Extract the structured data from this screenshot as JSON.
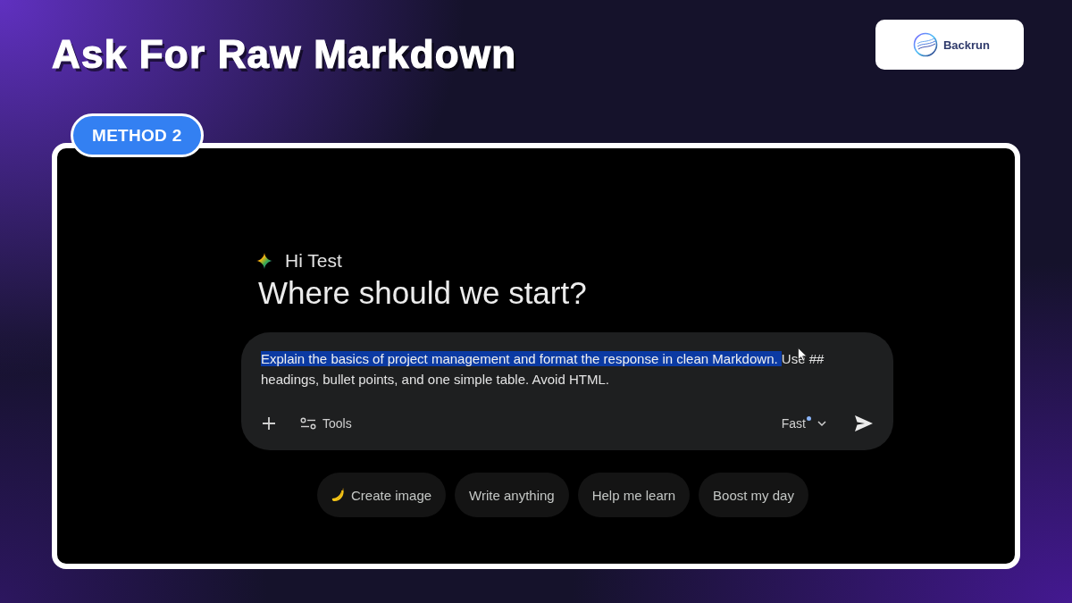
{
  "header": {
    "title": "Ask For Raw Markdown",
    "logo": {
      "text": "Backrun"
    }
  },
  "badge": "METHOD 2",
  "app": {
    "greeting": "Hi Test",
    "headline": "Where should we start?",
    "prompt": {
      "highlighted_text": "Explain the basics of project management and format the response in clean Markdown. ",
      "text": "Use ## headings, bullet points, and one simple table. Avoid HTML."
    },
    "tools_label": "Tools",
    "model": "Fast",
    "suggestions": [
      {
        "label": "Create image",
        "kind": "with-icon"
      },
      {
        "label": "Write anything",
        "kind": "text"
      },
      {
        "label": "Help me learn",
        "kind": "text"
      },
      {
        "label": "Boost my day",
        "kind": "text"
      }
    ]
  }
}
